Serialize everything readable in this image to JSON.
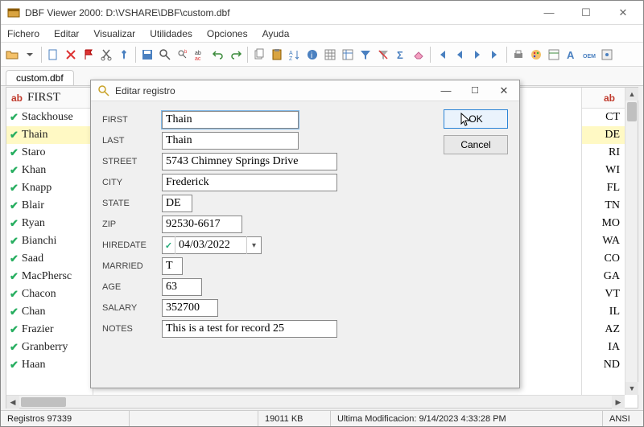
{
  "title": "DBF Viewer 2000: D:\\VSHARE\\DBF\\custom.dbf",
  "menu": {
    "file": "Fichero",
    "edit": "Editar",
    "view": "Visualizar",
    "tools": "Utilidades",
    "options": "Opciones",
    "help": "Ayuda"
  },
  "tab": {
    "label": "custom.dbf"
  },
  "grid": {
    "left_header": "FIRST",
    "right_header": "ab",
    "rows": [
      {
        "name": "Stackhouse",
        "state": "CT",
        "highlight": false
      },
      {
        "name": "Thain",
        "state": "DE",
        "highlight": true
      },
      {
        "name": "Staro",
        "state": "RI",
        "highlight": false
      },
      {
        "name": "Khan",
        "state": "WI",
        "highlight": false
      },
      {
        "name": "Knapp",
        "state": "FL",
        "highlight": false
      },
      {
        "name": "Blair",
        "state": "TN",
        "highlight": false
      },
      {
        "name": "Ryan",
        "state": "MO",
        "highlight": false
      },
      {
        "name": "Bianchi",
        "state": "WA",
        "highlight": false
      },
      {
        "name": "Saad",
        "state": "CO",
        "highlight": false
      },
      {
        "name": "MacPhersc",
        "state": "GA",
        "highlight": false
      },
      {
        "name": "Chacon",
        "state": "VT",
        "highlight": false
      },
      {
        "name": "Chan",
        "state": "IL",
        "highlight": false
      },
      {
        "name": "Frazier",
        "state": "AZ",
        "highlight": false
      },
      {
        "name": "Granberry",
        "state": "IA",
        "highlight": false
      },
      {
        "name": "Haan",
        "state": "ND",
        "highlight": false
      }
    ]
  },
  "dialog": {
    "title": "Editar registro",
    "ok": "OK",
    "cancel": "Cancel",
    "fields": {
      "first": {
        "label": "FIRST",
        "value": "Thain"
      },
      "last": {
        "label": "LAST",
        "value": "Thain"
      },
      "street": {
        "label": "STREET",
        "value": "5743 Chimney Springs Drive"
      },
      "city": {
        "label": "CITY",
        "value": "Frederick"
      },
      "state": {
        "label": "STATE",
        "value": "DE"
      },
      "zip": {
        "label": "ZIP",
        "value": "92530-6617"
      },
      "hiredate": {
        "label": "HIREDATE",
        "value": "04/03/2022"
      },
      "married": {
        "label": "MARRIED",
        "value": "T"
      },
      "age": {
        "label": "AGE",
        "value": "63"
      },
      "salary": {
        "label": "SALARY",
        "value": "352700"
      },
      "notes": {
        "label": "NOTES",
        "value": "This is a test for record 25"
      }
    }
  },
  "status": {
    "records": "Registros 97339",
    "size": "19011 KB",
    "modified": "Ultima Modificacion: 9/14/2023 4:33:28 PM",
    "encoding": "ANSI"
  }
}
